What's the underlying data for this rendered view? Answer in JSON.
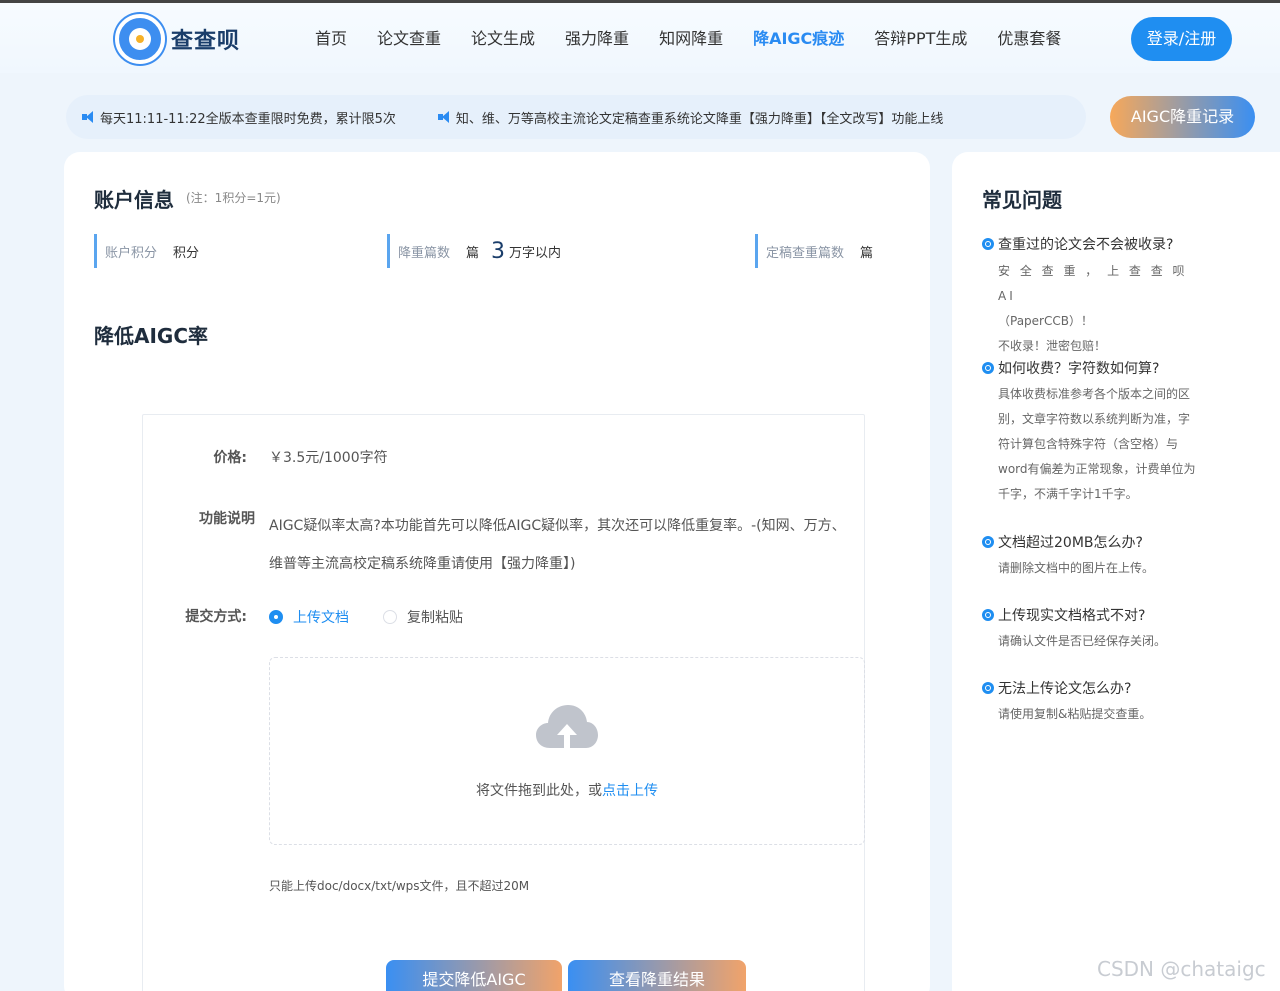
{
  "brand": {
    "name": "查查呗",
    "logo_icon": "dog-logo-icon"
  },
  "nav": {
    "items": [
      "首页",
      "论文查重",
      "论文生成",
      "强力降重",
      "知网降重",
      "降AIGC痕迹",
      "答辩PPT生成",
      "优惠套餐"
    ],
    "active_index": 5,
    "login_label": "登录/注册"
  },
  "notices": [
    "每天11:11-11:22全版本查重限时免费，累计限5次",
    "知、维、万等高校主流论文定稿查重系统论文降重【强力降重】【全文改写】功能上线"
  ],
  "aigc_record_label": "AIGC降重记录",
  "account": {
    "title": "账户信息",
    "note": "(注：1积分=1元)",
    "stats": [
      {
        "label": "账户积分",
        "value": "积分"
      },
      {
        "label": "降重篇数",
        "value": "篇",
        "big": "3",
        "suffix": "万字以内"
      },
      {
        "label": "定稿查重篇数",
        "value": "篇"
      }
    ]
  },
  "aigc": {
    "title": "降低AIGC率",
    "price_label": "价格:",
    "price": "￥3.5元/1000字符",
    "desc_label": "功能说明",
    "desc": "AIGC疑似率太高?本功能首先可以降低AIGC疑似率，其次还可以降低重复率。-(知网、万方、维普等主流高校定稿系统降重请使用【强力降重】)",
    "submit_label": "提交方式:",
    "options": [
      "上传文档",
      "复制粘贴"
    ],
    "selected_option": 0,
    "upload_text": "将文件拖到此处，或",
    "upload_link": "点击上传",
    "upload_tip": "只能上传doc/docx/txt/wps文件，且不超过20M",
    "submit_button": "提交降低AIGC",
    "result_button": "查看降重结果"
  },
  "faq": {
    "title": "常见问题",
    "items": [
      {
        "q": "查重过的论文会不会被收录?",
        "a": [
          "安 全 查 重 ， 上 查 查 呗 AI",
          "（PaperCCB）！",
          "不收录！泄密包赔！"
        ]
      },
      {
        "q": "如何收费？字符数如何算?",
        "a": [
          "具体收费标准参考各个版本之间的区",
          "别，文章字符数以系统判断为准，字",
          "符计算包含特殊字符（含空格）与",
          "word有偏差为正常现象，计费单位为",
          "千字，不满千字计1千字。"
        ]
      },
      {
        "q": "文档超过20MB怎么办?",
        "a": [
          "请删除文档中的图片在上传。"
        ]
      },
      {
        "q": "上传现实文档格式不对?",
        "a": [
          "请确认文件是否已经保存关闭。"
        ]
      },
      {
        "q": "无法上传论文怎么办?",
        "a": [
          "请使用复制&粘贴提交查重。"
        ]
      }
    ]
  },
  "watermark": "CSDN @chataigc"
}
